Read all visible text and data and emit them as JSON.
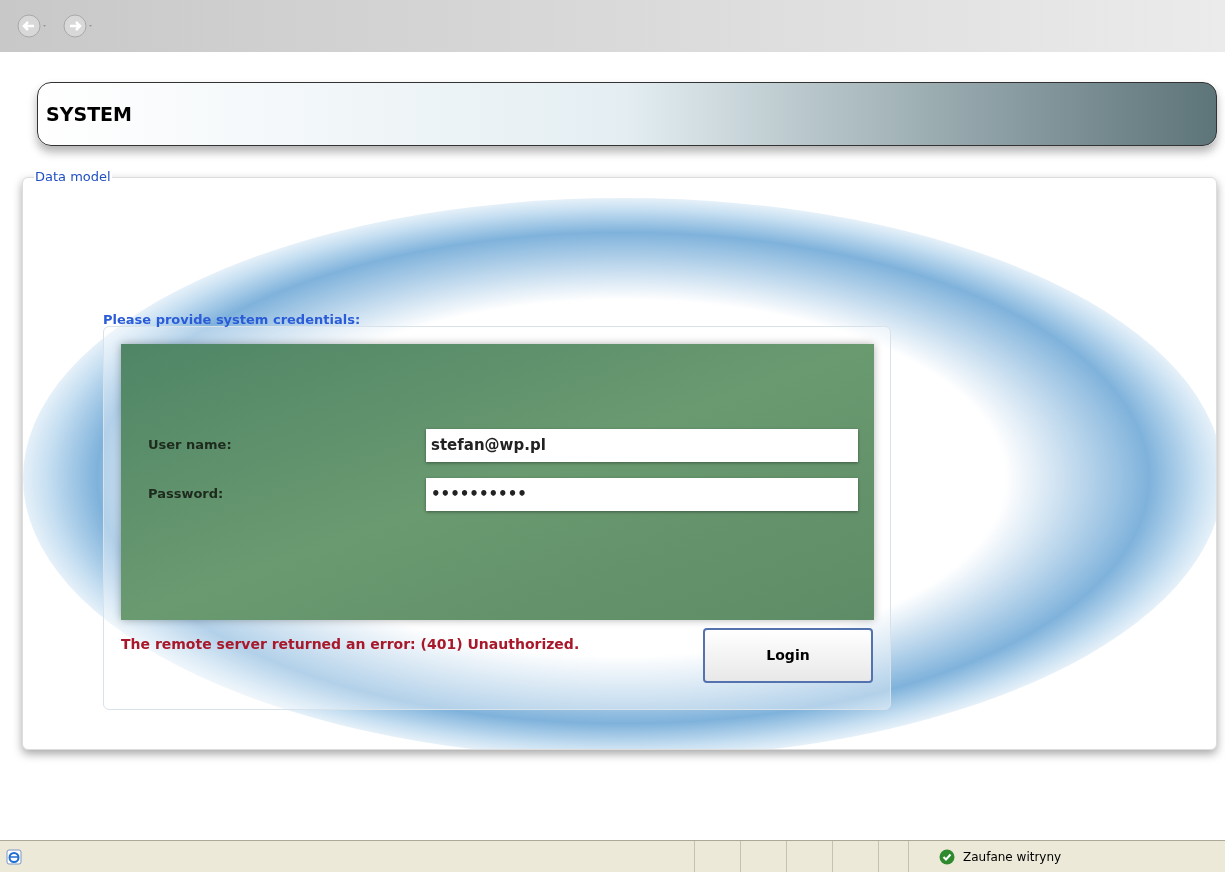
{
  "header": {
    "title": "SYSTEM"
  },
  "panel": {
    "legend": "Data model"
  },
  "login": {
    "heading": "Please provide system credentials:",
    "fields": [
      {
        "label": "User name:",
        "value": "stefan@wp.pl"
      },
      {
        "label": "Password:",
        "value": "••••••••••"
      }
    ],
    "error": "The remote server returned an error: (401) Unauthorized.",
    "button": "Login"
  },
  "status_bar": {
    "zone": "Zaufane witryny"
  }
}
